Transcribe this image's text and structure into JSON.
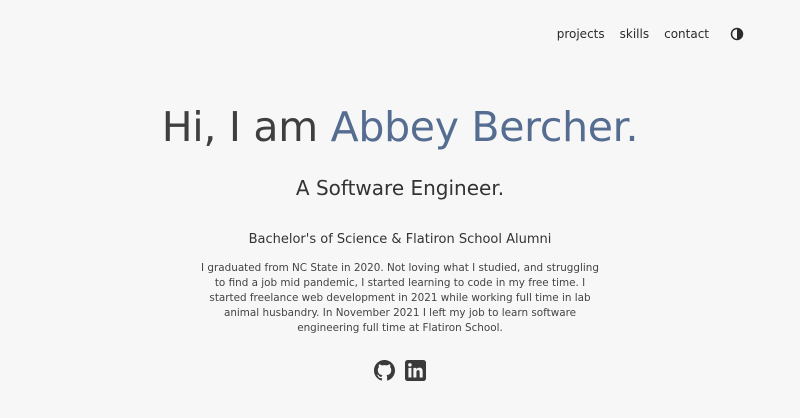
{
  "nav": {
    "items": [
      {
        "label": "projects"
      },
      {
        "label": "skills"
      },
      {
        "label": "contact"
      }
    ],
    "theme_toggle_icon": "half-moon-icon"
  },
  "hero": {
    "greeting": "Hi, I am ",
    "name": "Abbey Bercher.",
    "name_color": "#556d91",
    "subtitle": "A Software Engineer.",
    "degree": "Bachelor's of Science & Flatiron School Alumni",
    "bio": "I graduated from NC State in 2020. Not loving what I studied, and struggling to find a job mid pandemic, I started learning to code in my free time. I started freelance web development in 2021 while working full time in lab animal husbandry. In November 2021 I left my job to learn software engineering full time at Flatiron School."
  },
  "socials": [
    {
      "icon": "github-icon"
    },
    {
      "icon": "linkedin-icon"
    }
  ]
}
